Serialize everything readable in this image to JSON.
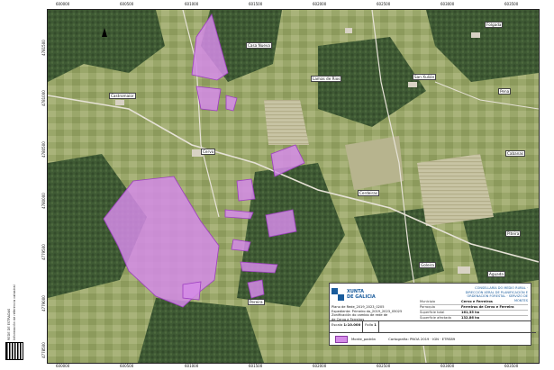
{
  "side_panel": {
    "line1": "REDE DE ESTRADAS",
    "line2": "Información de referencia catastral"
  },
  "top_coords": [
    "600000",
    "600500",
    "601000",
    "601500",
    "602000",
    "602500",
    "603000",
    "603500",
    "604000",
    "604500",
    "605000",
    "605500",
    "606000"
  ],
  "bottom_coords": [
    "600000",
    "600500",
    "601000",
    "601500",
    "602000",
    "602500",
    "603000",
    "603500",
    "604000",
    "604500",
    "605000",
    "605500",
    "606000"
  ],
  "left_coords": [
    "4781500",
    "4781000",
    "4780500",
    "4780000",
    "4779500",
    "4779000",
    "4778500"
  ],
  "places": {
    "casa_nueva": "Casa Nueva",
    "lamas_de_rios": "Lamas de Rios",
    "castromaior": "Castromaior",
    "sao_xulian": "San Xulián",
    "cervo": "Cervo",
    "cerdeiras": "Cerdeiras",
    "cabanas": "Cabanas",
    "piteira": "Piteira",
    "goleira": "Goleira",
    "pena": "Pena",
    "folga": "Folgada",
    "aguada": "Aguada",
    "pereira": "Pereira"
  },
  "legend": {
    "logo_line1": "XUNTA",
    "logo_line2": "DE GALICIA",
    "consellaria": "CONSELLARÍA DO MEDIO RURAL · DIRECCIÓN XERAL DE PLANIFICACIÓN E ORDENACIÓN FORESTAL · SERVIZO DE MONTES",
    "plan_line1": "Plano de Rede_2019_2023_0205",
    "plan_line2": "Expediente: Primeiro do_2019_2023_05025",
    "plan_line3": "Zonificación do cambio de rede de",
    "plan_line4": "de Cervo e Ferreiros",
    "muni_label": "Municipio",
    "muni_value": "Cervo e Ferreiros",
    "parish_label": "Parroquia",
    "parish_value": "Ferreiros de Cervo e Ferreira",
    "area_label": "Superficie total",
    "area_value": "161,35 ha",
    "area2_label": "Superficie afectada",
    "area2_value": "132,86 ha",
    "scale_label": "Escala",
    "scale_value": "1:10.000",
    "sheet_label": "Folla",
    "sheet_value": "1",
    "legend_item": "Monte_padrón",
    "ortho_note": "Cartografía: PNOA 2019 · IGN · ETRS89"
  },
  "colors": {
    "polygon_fill": "#d58be8",
    "polygon_stroke": "#9d3fc0"
  }
}
